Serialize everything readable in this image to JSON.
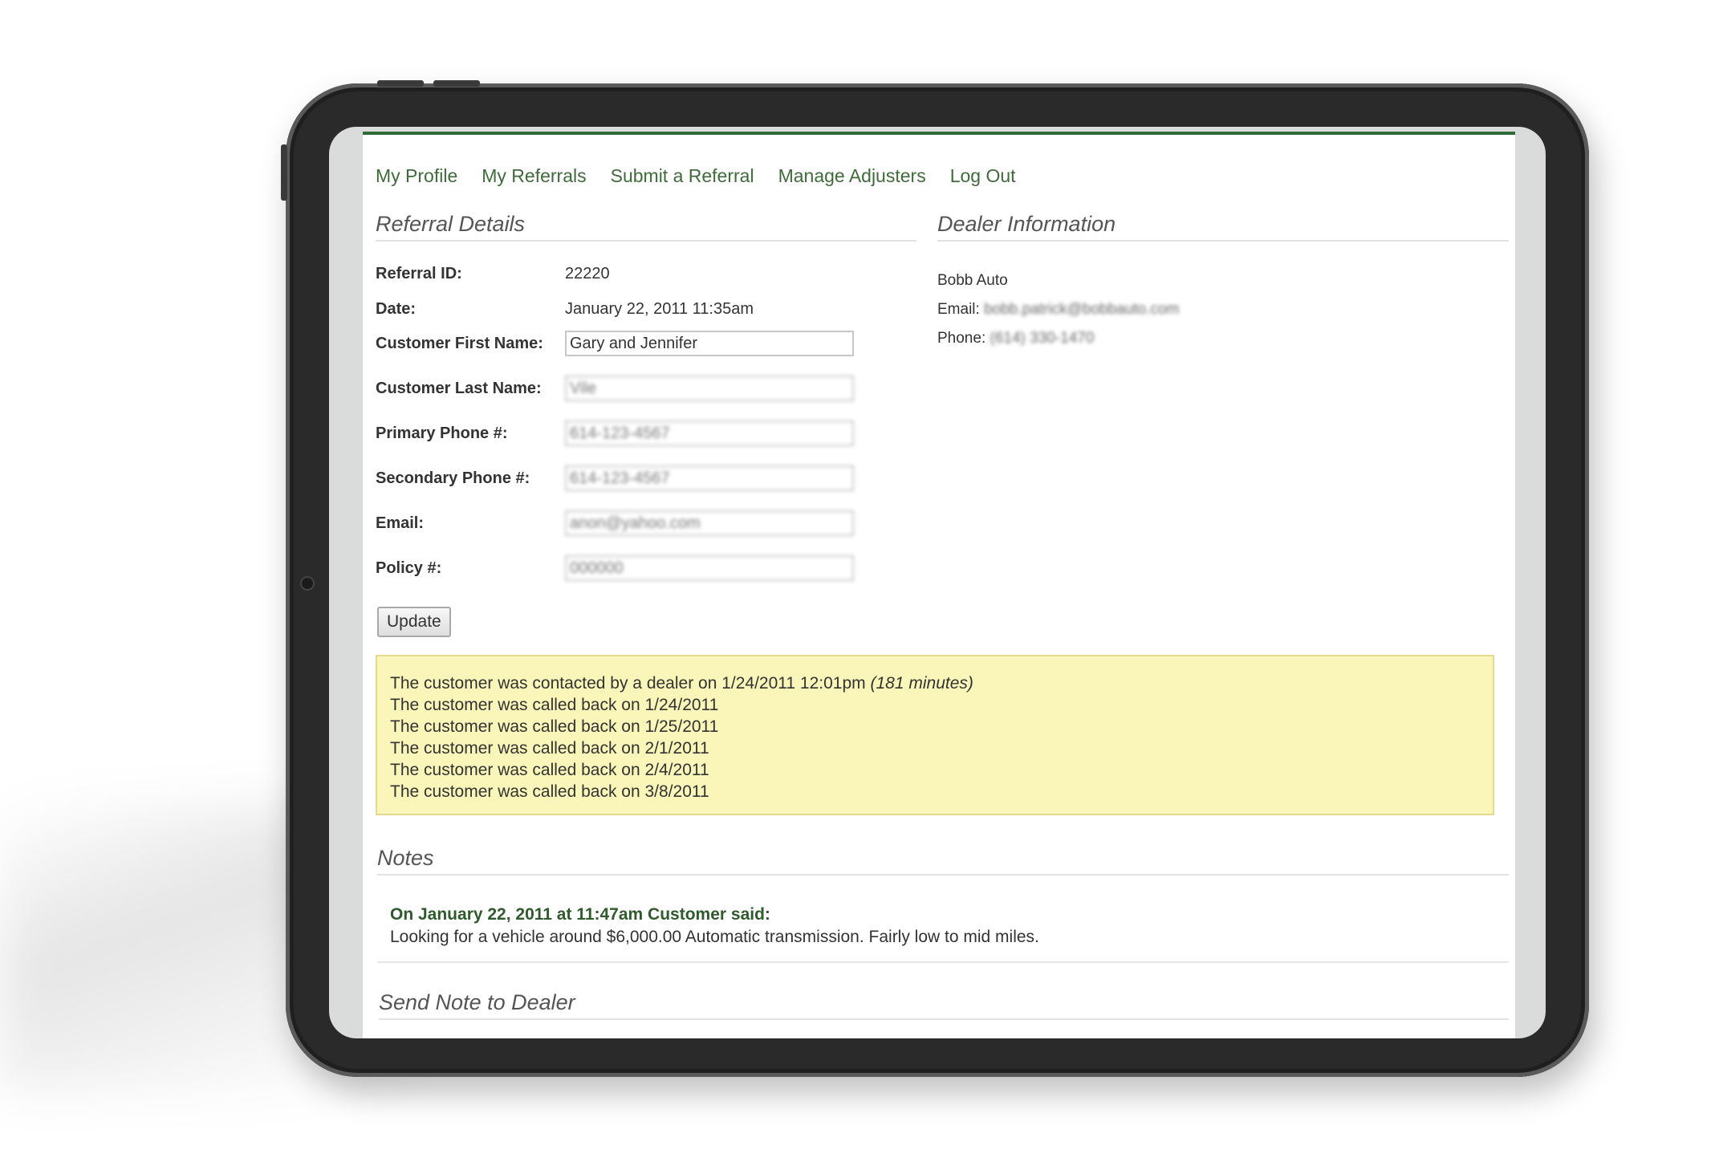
{
  "nav": {
    "my_profile": "My Profile",
    "my_referrals": "My Referrals",
    "submit_referral": "Submit a Referral",
    "manage_adjusters": "Manage Adjusters",
    "log_out": "Log Out"
  },
  "referral": {
    "title": "Referral Details",
    "id_label": "Referral ID:",
    "id_value": "22220",
    "date_label": "Date:",
    "date_value": "January 22, 2011 11:35am",
    "first_name_label": "Customer First Name:",
    "first_name_value": "Gary and Jennifer",
    "last_name_label": "Customer Last Name:",
    "last_name_value": "Vile",
    "primary_phone_label": "Primary Phone #:",
    "primary_phone_value": "614-123-4567",
    "secondary_phone_label": "Secondary Phone #:",
    "secondary_phone_value": "614-123-4567",
    "email_label": "Email:",
    "email_value": "anon@yahoo.com",
    "policy_label": "Policy #:",
    "policy_value": "000000",
    "update_button": "Update"
  },
  "dealer": {
    "title": "Dealer Information",
    "name": "Bobb Auto",
    "email_label": "Email:",
    "email_value": "bobb.patrick@bobbauto.com",
    "phone_label": "Phone:",
    "phone_value": "(614) 330-1470"
  },
  "history": {
    "contacted_text": "The customer was contacted by a dealer on 1/24/2011 12:01pm",
    "contacted_duration": "(181 minutes)",
    "callbacks": [
      "The customer was called back on 1/24/2011",
      "The customer was called back on 1/25/2011",
      "The customer was called back on 2/1/2011",
      "The customer was called back on 2/4/2011",
      "The customer was called back on 3/8/2011"
    ]
  },
  "notes": {
    "title": "Notes",
    "entry_header": "On January 22, 2011 at 11:47am Customer said:",
    "entry_body": "Looking for a vehicle around $6,000.00 Automatic transmission. Fairly low to mid miles."
  },
  "send_note": {
    "title": "Send Note to Dealer"
  },
  "colors": {
    "accent_green": "#2e6b36",
    "link_green": "#3f6b3a",
    "history_bg": "#faf5b8"
  }
}
